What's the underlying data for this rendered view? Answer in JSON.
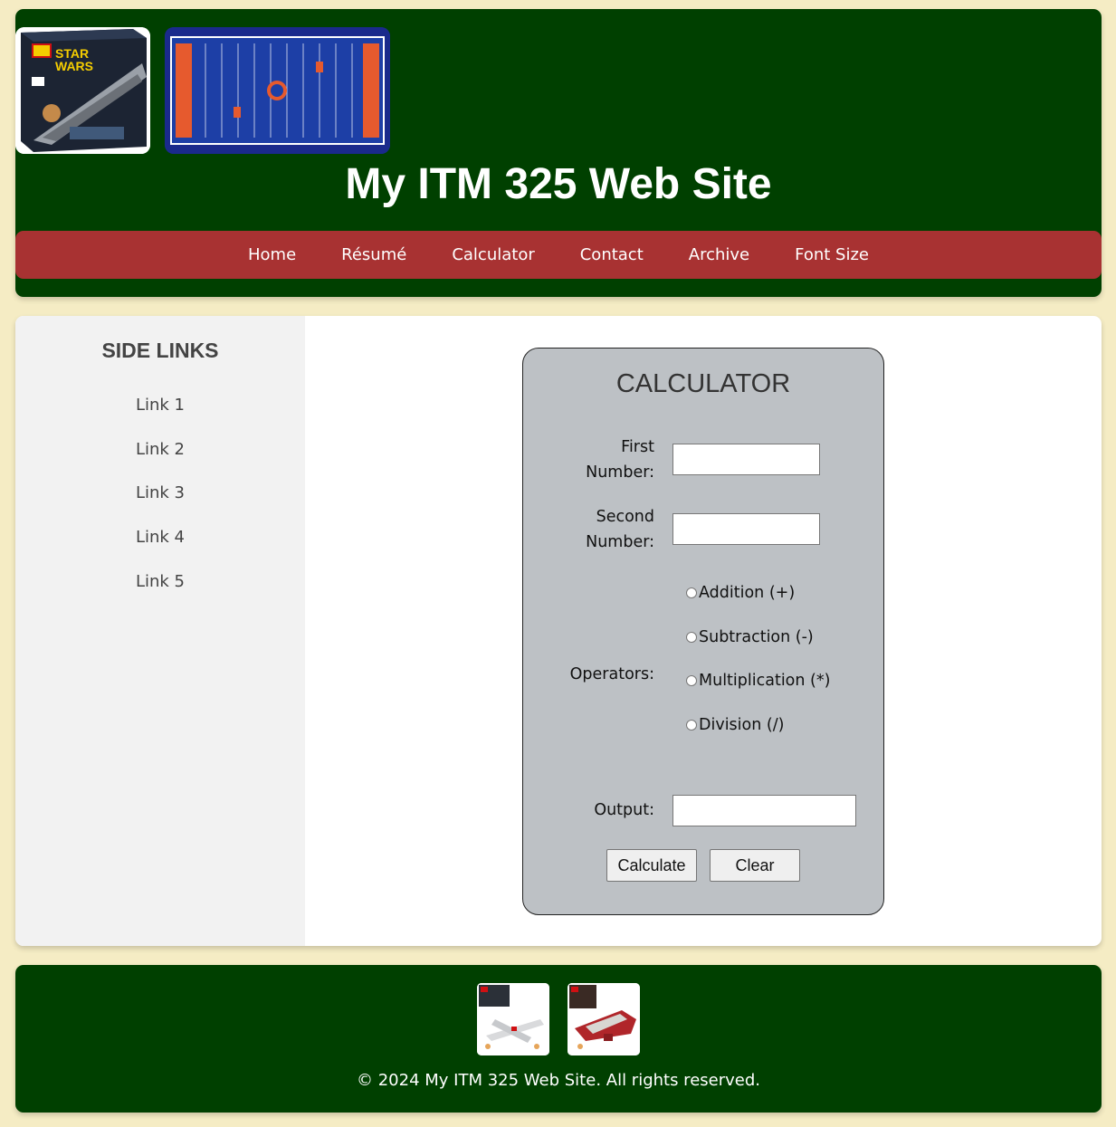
{
  "header": {
    "title": "My ITM 325 Web Site",
    "nav": [
      "Home",
      "Résumé",
      "Calculator",
      "Contact",
      "Archive",
      "Font Size"
    ]
  },
  "sidebar": {
    "heading": "SIDE LINKS",
    "links": [
      "Link 1",
      "Link 2",
      "Link 3",
      "Link 4",
      "Link 5"
    ]
  },
  "calculator": {
    "title": "CALCULATOR",
    "first_label_line1": "First",
    "first_label_line2": "Number:",
    "first_value": "",
    "second_label_line1": "Second",
    "second_label_line2": "Number:",
    "second_value": "",
    "operators_label": "Operators:",
    "operators": [
      "Addition (+)",
      "Subtraction (-)",
      "Multiplication (*)",
      "Division (/)"
    ],
    "output_label": "Output:",
    "output_value": "",
    "calculate_label": "Calculate",
    "clear_label": "Clear"
  },
  "footer": {
    "copyright": "© 2024 My ITM 325 Web Site. All rights reserved."
  },
  "colors": {
    "page_bg": "#f5ecc4",
    "header_bg": "#004000",
    "nav_bg": "#a83232",
    "sidebar_bg": "#f2f2f2",
    "calc_bg": "#bdc1c5"
  }
}
